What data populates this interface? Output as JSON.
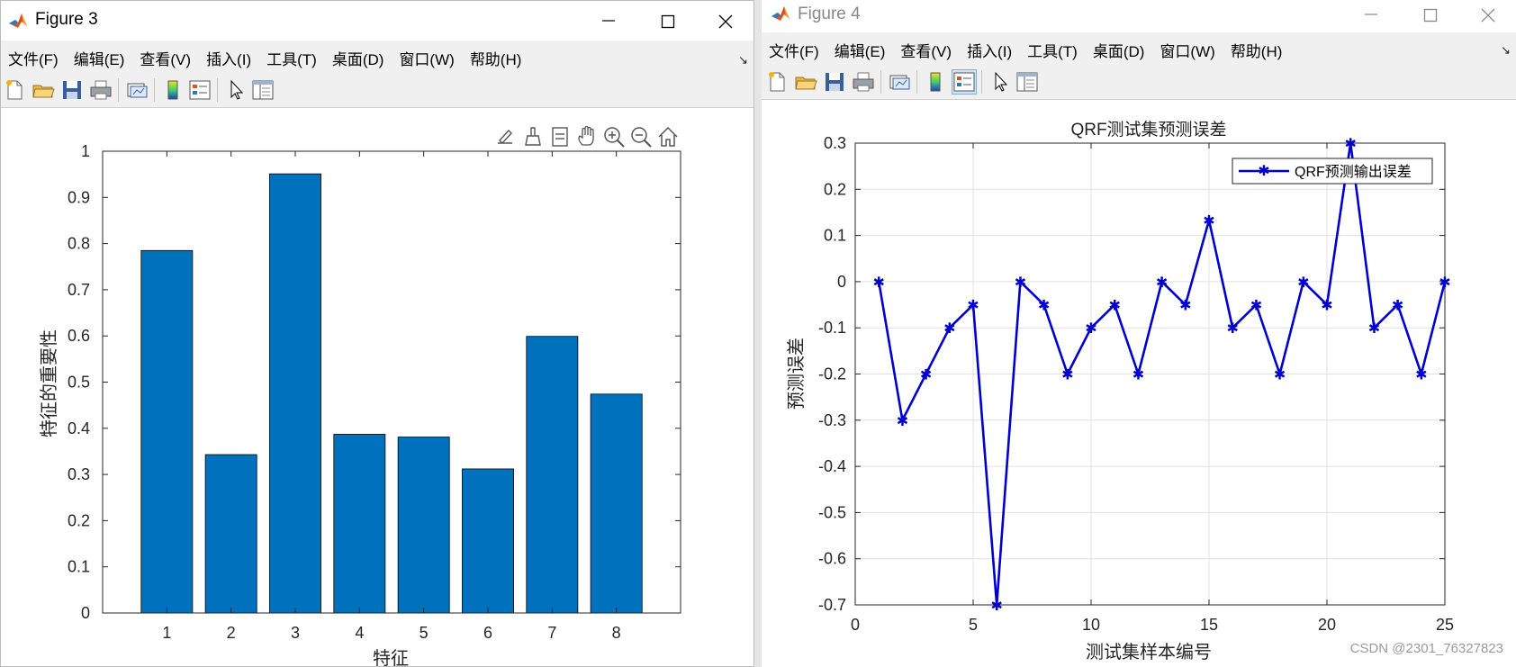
{
  "windows": [
    {
      "title": "Figure 3",
      "menus": [
        "文件(F)",
        "编辑(E)",
        "查看(V)",
        "插入(I)",
        "工具(T)",
        "桌面(D)",
        "窗口(W)",
        "帮助(H)"
      ]
    },
    {
      "title": "Figure 4",
      "menus": [
        "文件(F)",
        "编辑(E)",
        "查看(V)",
        "插入(I)",
        "工具(T)",
        "桌面(D)",
        "窗口(W)",
        "帮助(H)"
      ]
    }
  ],
  "toolbar_icons": [
    "new-file-icon",
    "open-folder-icon",
    "save-icon",
    "print-icon",
    "link-plot-icon",
    "colorbar-icon",
    "legend-icon",
    "pointer-icon",
    "property-editor-icon"
  ],
  "axes_toolbar_icons": [
    "export-icon",
    "brush-icon",
    "data-tips-icon",
    "pan-icon",
    "zoom-in-icon",
    "zoom-out-icon",
    "home-icon"
  ],
  "watermark": "CSDN @2301_76327823",
  "colors": {
    "bar": "#0072bd",
    "line": "#0000cd",
    "grid": "#e0e0e0"
  },
  "chart_data": [
    {
      "type": "bar",
      "title": "",
      "categories": [
        "1",
        "2",
        "3",
        "4",
        "5",
        "6",
        "7",
        "8"
      ],
      "values": [
        0.785,
        0.343,
        0.951,
        0.387,
        0.381,
        0.312,
        0.599,
        0.474
      ],
      "xlabel": "特征",
      "ylabel": "特征的重要性",
      "xlim": [
        0,
        9
      ],
      "ylim": [
        0,
        1
      ],
      "yticks": [
        0,
        0.1,
        0.2,
        0.3,
        0.4,
        0.5,
        0.6,
        0.7,
        0.8,
        0.9,
        1
      ],
      "yticklabels": [
        "0",
        "0.1",
        "0.2",
        "0.3",
        "0.4",
        "0.5",
        "0.6",
        "0.7",
        "0.8",
        "0.9",
        "1"
      ],
      "grid": false
    },
    {
      "type": "line",
      "title": "QRF测试集预测误差",
      "x": [
        1,
        2,
        3,
        4,
        5,
        6,
        7,
        8,
        9,
        10,
        11,
        12,
        13,
        14,
        15,
        16,
        17,
        18,
        19,
        20,
        21,
        22,
        23,
        24,
        25
      ],
      "series": [
        {
          "name": "QRF预测输出误差",
          "values": [
            0,
            -0.3,
            -0.2,
            -0.1,
            -0.05,
            -0.7,
            0,
            -0.05,
            -0.2,
            -0.1,
            -0.05,
            -0.2,
            0,
            -0.05,
            0.133,
            -0.1,
            -0.05,
            -0.2,
            0,
            -0.05,
            0.3,
            -0.1,
            -0.05,
            -0.2,
            0
          ]
        }
      ],
      "xlabel": "测试集样本编号",
      "ylabel": "预测误差",
      "xlim": [
        0,
        25
      ],
      "ylim": [
        -0.7,
        0.3
      ],
      "xticks": [
        0,
        5,
        10,
        15,
        20,
        25
      ],
      "xticklabels": [
        "0",
        "5",
        "10",
        "15",
        "20",
        "25"
      ],
      "yticks": [
        0.3,
        0.2,
        0.1,
        0,
        -0.1,
        -0.2,
        -0.3,
        -0.4,
        -0.5,
        -0.6,
        -0.7
      ],
      "yticklabels": [
        "0.3",
        "0.2",
        "0.1",
        "0",
        "-0.1",
        "-0.2",
        "-0.3",
        "-0.4",
        "-0.5",
        "-0.6",
        "-0.7"
      ],
      "grid": true,
      "legend": "top-right"
    }
  ]
}
